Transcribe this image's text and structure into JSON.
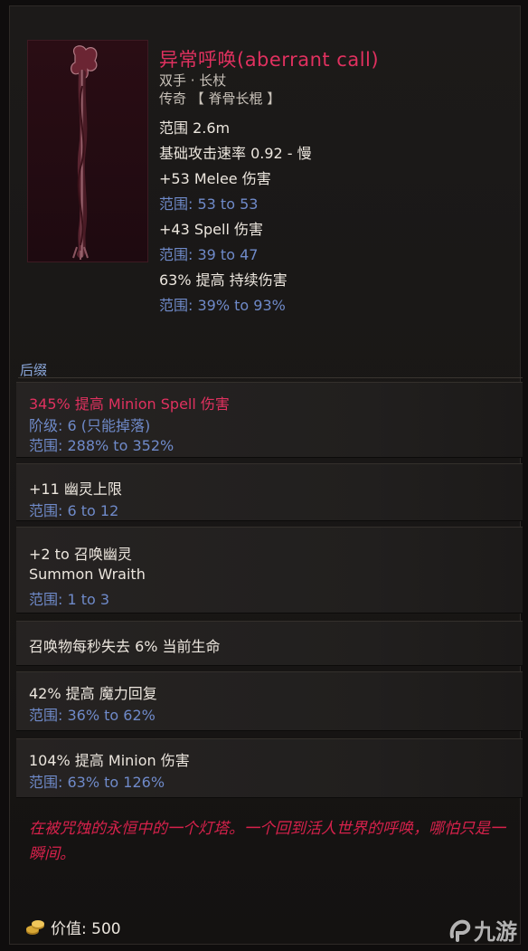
{
  "item": {
    "name": "异常呼唤(aberrant call)",
    "type": "双手 · 长杖",
    "rarity": "传奇 【 脊骨长棍 】",
    "stats": [
      {
        "text": "范围 2.6m"
      },
      {
        "text": "基础攻击速率 0.92 - 慢"
      },
      {
        "text": "+53 Melee 伤害",
        "range": "范围: 53 to 53"
      },
      {
        "text": "+43 Spell 伤害",
        "range": "范围: 39 to 47"
      },
      {
        "text": "63% 提高 持续伤害",
        "range": "范围: 39% to 93%"
      }
    ]
  },
  "affix_section": {
    "title": "后缀",
    "affixes": [
      {
        "lines": [
          "345% 提高 Minion Spell 伤害",
          "阶级: 6 (只能掉落)",
          "范围: 288% to 352%"
        ]
      },
      {
        "lines": [
          "+11 幽灵上限",
          "范围: 6 to 12"
        ]
      },
      {
        "lines": [
          "+2 to 召唤幽灵",
          "Summon Wraith",
          "范围: 1 to 3"
        ]
      },
      {
        "lines": [
          "召唤物每秒失去 6% 当前生命"
        ]
      },
      {
        "lines": [
          "42% 提高 魔力回复",
          "范围: 36% to 62%"
        ]
      },
      {
        "lines": [
          "104% 提高 Minion 伤害",
          "范围: 63% to 126%"
        ]
      }
    ]
  },
  "lore": "在被咒蚀的永恒中的一个灯塔。一个回到活人世界的呼唤，哪怕只是一瞬间。",
  "value": "价值: 500",
  "watermark": "九游",
  "colors": {
    "title": "#e0315f",
    "range": "#6f8ac9",
    "lore": "#d6214b"
  },
  "icons": [
    "staff-item-image",
    "gold-coin-icon",
    "watermark-logo-icon"
  ]
}
